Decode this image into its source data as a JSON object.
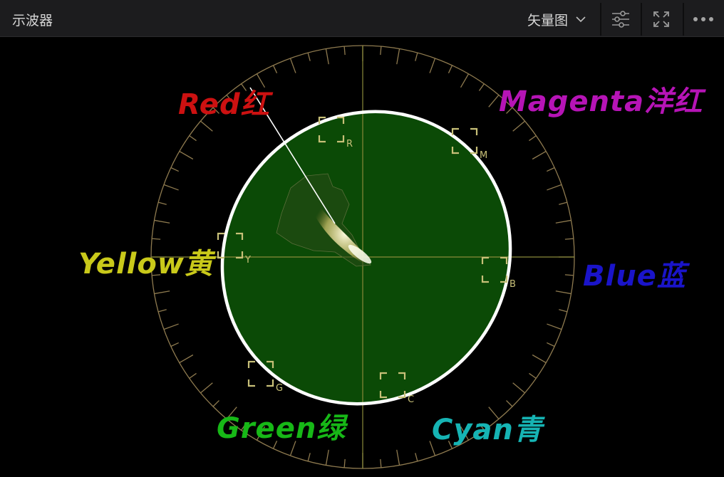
{
  "panel": {
    "title": "示波器"
  },
  "toolbar": {
    "view_label": "矢量图",
    "icons": [
      "chevron-down-icon",
      "sliders-icon",
      "expand-icon",
      "more-icon"
    ]
  },
  "scope": {
    "targets": {
      "r": "R",
      "m": "M",
      "y": "Y",
      "b": "B",
      "g": "G",
      "c": "C"
    },
    "colors": {
      "graticule": "#8e7a4f",
      "crosshair": "#8a8a3a",
      "target": "#c8c078",
      "fill": "#0b4a06",
      "outline": "#ffffff"
    }
  },
  "annotations": {
    "red": {
      "text": "Red红",
      "color": "#cc1111"
    },
    "magenta": {
      "text": "Magenta洋红",
      "color": "#b614b6"
    },
    "yellow": {
      "text": "Yellow黄",
      "color": "#c9c91a"
    },
    "blue": {
      "text": "Blue蓝",
      "color": "#1a14c9"
    },
    "green": {
      "text": "Green绿",
      "color": "#17b817"
    },
    "cyan": {
      "text": "Cyan青",
      "color": "#16b4b4"
    }
  }
}
